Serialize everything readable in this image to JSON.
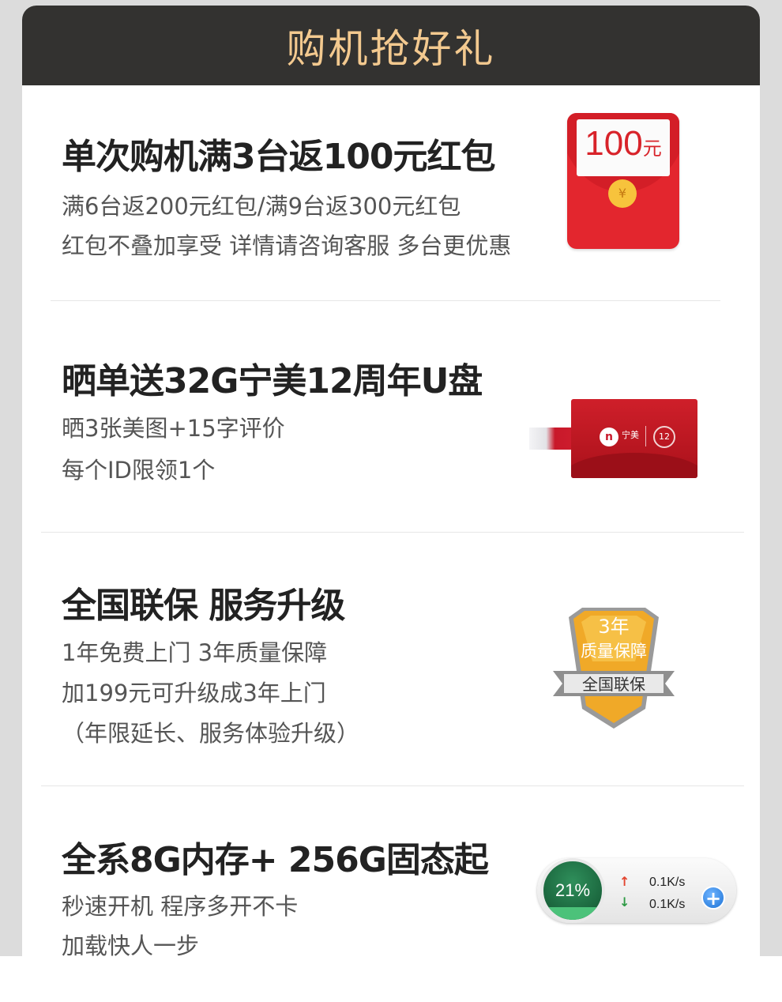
{
  "header": {
    "title": "购机抢好礼"
  },
  "sections": [
    {
      "title": "单次购机满3台返100元红包",
      "lines": [
        "满6台返200元红包/满9台返300元红包",
        "红包不叠加享受 详情请咨询客服 多台更优惠"
      ],
      "image": {
        "amount": "100",
        "unit": "元",
        "coin": "¥"
      }
    },
    {
      "title": "晒单送32G宁美12周年U盘",
      "lines": [
        "晒3张美图+15字评价",
        "每个ID限领1个"
      ],
      "image": {
        "brand": "宁美",
        "badge": "12"
      }
    },
    {
      "title": "全国联保  服务升级",
      "lines": [
        "1年免费上门  3年质量保障",
        "加199元可升级成3年上门",
        "（年限延长、服务体验升级）"
      ],
      "image": {
        "line1": "3年",
        "line2": "质量保障",
        "ribbon": "全国联保"
      }
    },
    {
      "title": "全系8G内存+ 256G固态起",
      "lines": [
        "秒速开机 程序多开不卡",
        "加载快人一步"
      ],
      "image": {
        "percent": "21%",
        "percent_value": 0.21,
        "upload": "0.1K/s",
        "download": "0.1K/s",
        "up_arrow": "↑",
        "down_arrow": "↓",
        "plus": "+"
      }
    }
  ],
  "colors": {
    "header_bg": "#333230",
    "header_text": "#f3c98f",
    "title": "#222222",
    "text": "#555555",
    "envelope_red": "#e3262e"
  }
}
